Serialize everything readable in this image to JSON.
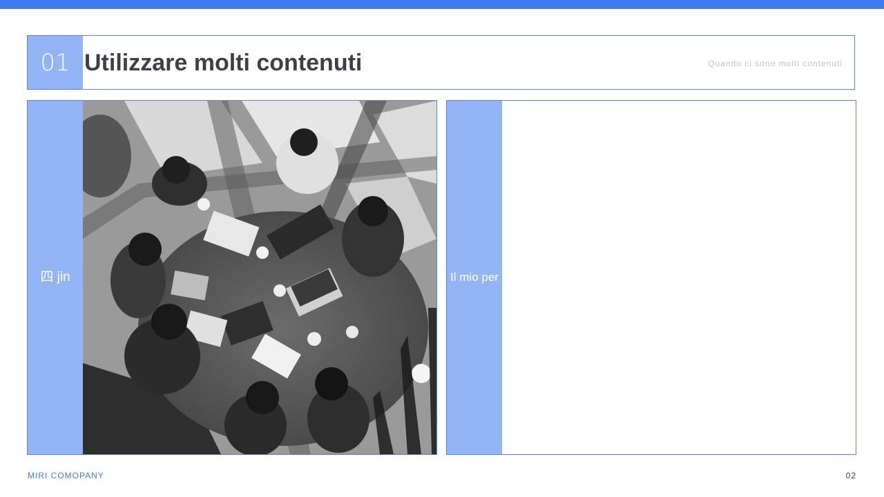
{
  "header": {
    "number": "01",
    "title": "Utilizzare molti contenuti",
    "subtitle": "Quando ci sono molti contenuti"
  },
  "left_card": {
    "label": "四  jin",
    "image": "grayscale aerial photo of people meeting around a round table with laptops"
  },
  "right_card": {
    "label": "Il mio  per"
  },
  "footer": {
    "company": "MIRI COMOPANY",
    "page": "02"
  },
  "colors": {
    "accent": "#3b7ded",
    "label_bg": "#94b5f5",
    "border": "#4f86e8",
    "title": "#3f3f46"
  }
}
